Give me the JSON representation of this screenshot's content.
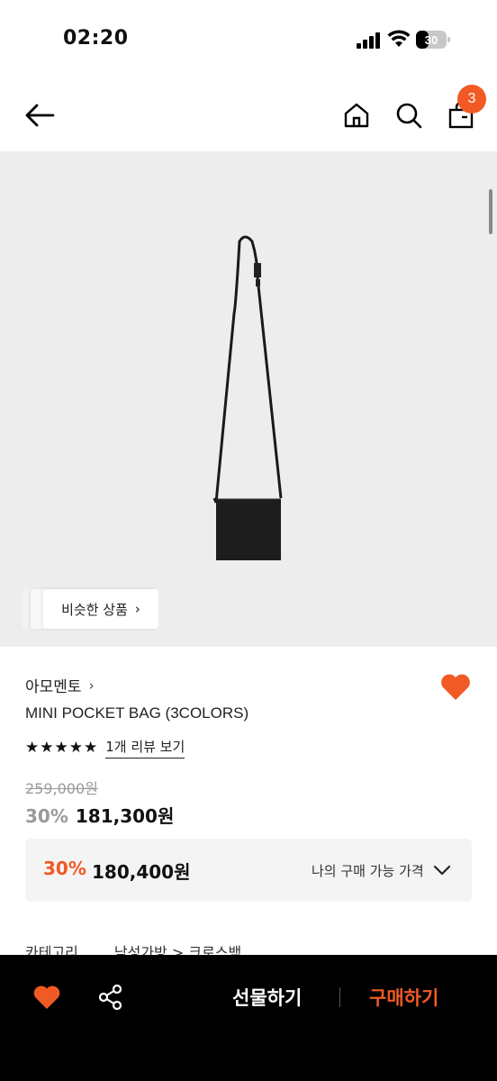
{
  "status_bar": {
    "time": "02:20",
    "battery": "30"
  },
  "header": {
    "cart_count": "3"
  },
  "image": {
    "similar_label": "비슷한 상품"
  },
  "product": {
    "brand": "아모멘토",
    "name": "MINI POCKET BAG (3COLORS)",
    "stars": "★★★★★",
    "review_link": "1개 리뷰 보기",
    "original_price": "259,000원",
    "sale_percent": "30%",
    "sale_price": "181,300원"
  },
  "my_price": {
    "percent": "30%",
    "price": "180,400원",
    "label": "나의 구매 가능 가격"
  },
  "category": {
    "label": "카테고리",
    "value": "남성가방 > 크로스백"
  },
  "bottom_bar": {
    "gift_label": "선물하기",
    "buy_label": "구매하기"
  },
  "colors": {
    "accent": "#f15a24",
    "image_bg": "#ededed",
    "bar_bg": "#000000"
  },
  "icons": [
    "back-arrow-icon",
    "home-icon",
    "search-icon",
    "cart-icon",
    "heart-icon",
    "share-icon",
    "chevron-down-icon"
  ]
}
